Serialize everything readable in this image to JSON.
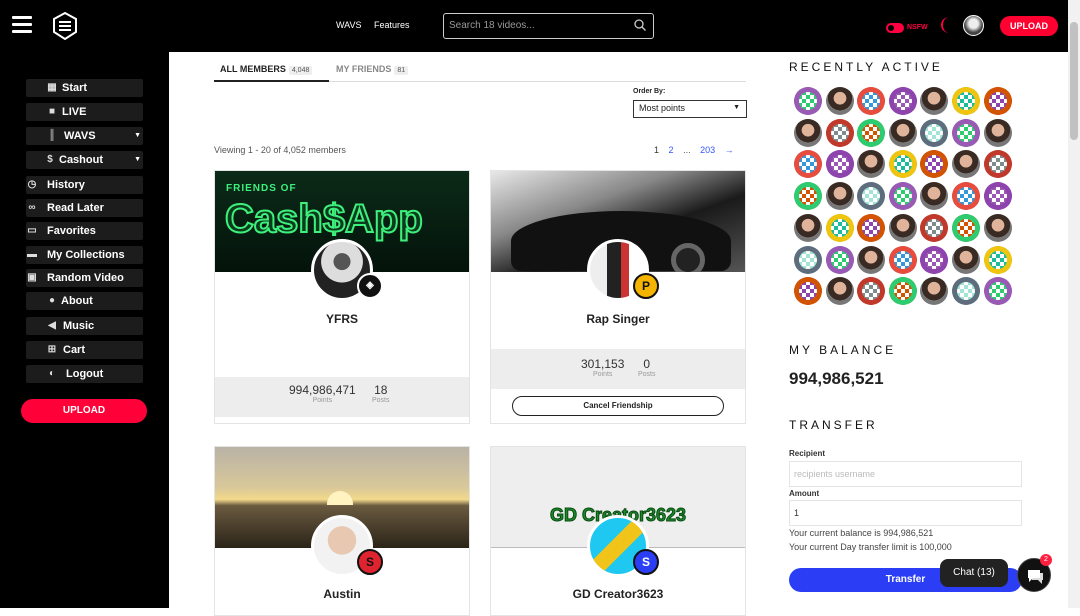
{
  "topbar": {
    "nav": [
      "WAVS",
      "Features"
    ],
    "search_placeholder": "Search 18 videos...",
    "nsfw_label": "NSFW",
    "upload_label": "UPLOAD"
  },
  "sidebar": {
    "items": [
      {
        "label": "Start",
        "icon": "film-icon"
      },
      {
        "label": "LIVE",
        "icon": "video-camera-icon"
      },
      {
        "label": "WAVS",
        "icon": "barcode-icon"
      },
      {
        "label": "Cashout",
        "icon": "dollar-icon"
      },
      {
        "label": "History",
        "icon": "history-icon"
      },
      {
        "label": "Read Later",
        "icon": "glasses-icon"
      },
      {
        "label": "Favorites",
        "icon": "bookmark-icon"
      },
      {
        "label": "My Collections",
        "icon": "folder-icon"
      },
      {
        "label": "Random Video",
        "icon": "dice-icon"
      },
      {
        "label": "About",
        "icon": "user-icon"
      },
      {
        "label": "Music",
        "icon": "volume-icon"
      },
      {
        "label": "Cart",
        "icon": "cart-icon"
      },
      {
        "label": "Logout",
        "icon": "toggle-icon"
      }
    ],
    "upload_label": "UPLOAD"
  },
  "members": {
    "tabs": [
      {
        "label": "ALL MEMBERS",
        "count": "4,048"
      },
      {
        "label": "MY FRIENDS",
        "count": "81"
      }
    ],
    "order_label": "Order By:",
    "order_value": "Most points",
    "viewing": "Viewing 1 - 20 of 4,052 members",
    "pages": [
      "1",
      "2",
      "...",
      "203",
      "→"
    ],
    "cards": [
      {
        "name": "YFRS",
        "points": "994,986,471",
        "posts": "18",
        "points_label": "Points",
        "posts_label": "Posts",
        "cover_text_top": "FRIENDS OF",
        "cover_text": "Cash$App"
      },
      {
        "name": "Rap Singer",
        "points": "301,153",
        "posts": "0",
        "points_label": "Points",
        "posts_label": "Posts",
        "action": "Cancel Friendship"
      },
      {
        "name": "Austin"
      },
      {
        "name": "GD Creator3623",
        "cover_text": "GD Creator3623"
      }
    ]
  },
  "right": {
    "recently_active": "RECENTLY ACTIVE",
    "my_balance": "MY BALANCE",
    "balance": "994,986,521",
    "transfer": "TRANSFER",
    "recipient_label": "Recipient",
    "recipient_placeholder": "recipients username",
    "amount_label": "Amount",
    "amount_value": "1",
    "current_balance": "Your current balance is 994,986,521",
    "day_limit": "Your current Day transfer limit is 100,000",
    "transfer_button": "Transfer"
  },
  "chat": {
    "label": "Chat (13)",
    "badge": "2"
  },
  "colors": {
    "accent": "#ff0038",
    "link": "#3355ff",
    "transfer": "#2b3ef5"
  }
}
